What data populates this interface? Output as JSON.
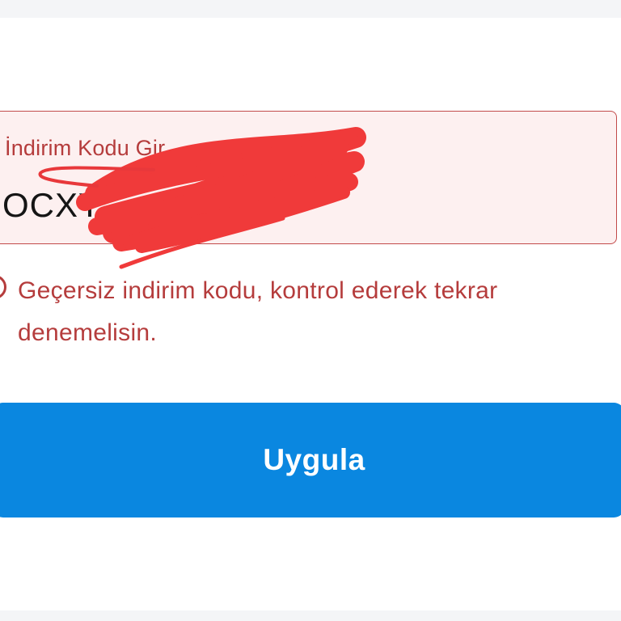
{
  "discount_form": {
    "field_label": "İndirim Kodu Gir",
    "field_value": "OCXY",
    "error_message": "Geçersiz indirim kodu, kontrol ederek tekrar denemelisin.",
    "apply_label": "Uygula"
  },
  "icons": {
    "error": "error-circle-icon"
  },
  "colors": {
    "error": "#b53c3c",
    "error_background": "#fdf0f0",
    "primary": "#0a87e0",
    "redaction": "#f03a3a"
  }
}
